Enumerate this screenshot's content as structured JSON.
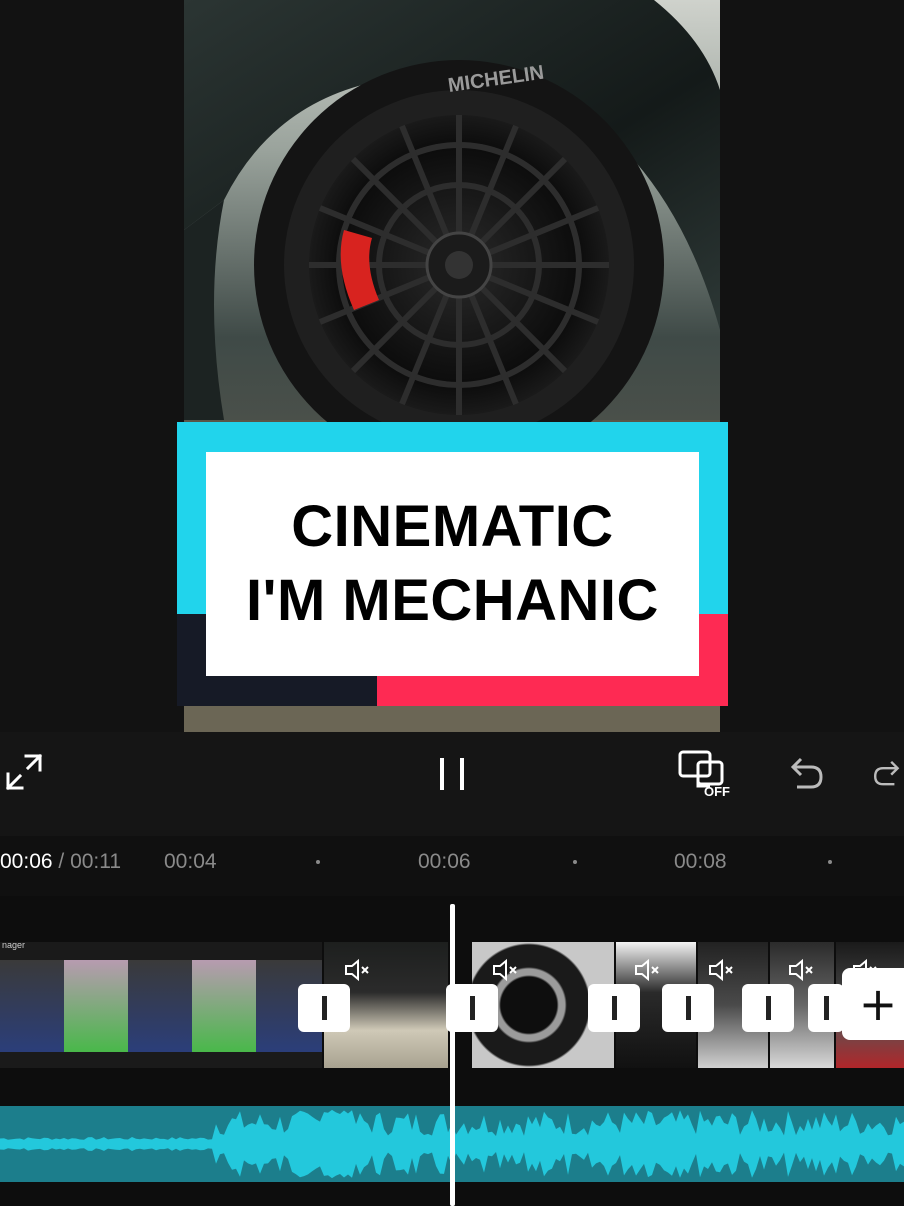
{
  "preview": {
    "title_card": {
      "line1": "CINEMATIC",
      "line2": "I'M MECHANIC",
      "colors": {
        "cyan": "#21d4ec",
        "pink": "#fe2a53",
        "dark": "#161a26",
        "panel": "#ffffff"
      }
    },
    "tire_brand": "MICHELIN"
  },
  "toolbar": {
    "fullscreen_icon": "expand-icon",
    "play_pause_icon": "pause-icon",
    "keyframe_label": "OFF",
    "undo_icon": "undo-icon",
    "redo_icon": "redo-icon"
  },
  "timeline": {
    "current_time": "00:06",
    "separator": " / ",
    "total_time": "00:11",
    "ticks": [
      "00:04",
      "00:06",
      "00:08"
    ],
    "clip_label": "nager",
    "add_icon": "+",
    "accent": "#23c8dc"
  }
}
